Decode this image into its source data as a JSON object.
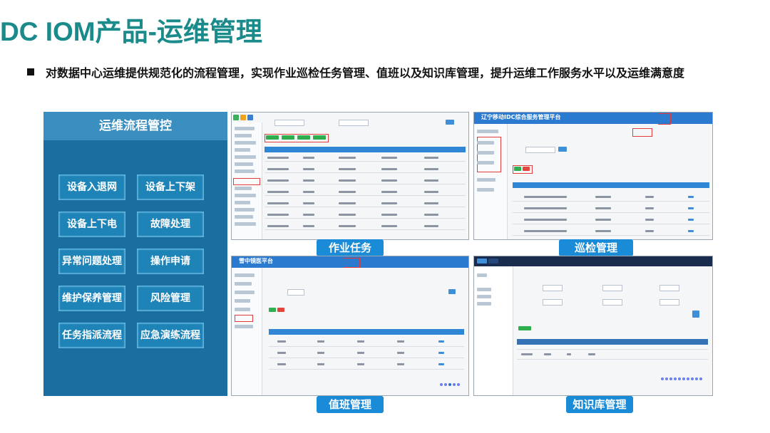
{
  "title": "DC IOM产品-运维管理",
  "bullet": "对数据中心运维提供规范化的流程管理，实现作业巡检任务管理、值班以及知识库管理，提升运维工作服务水平以及运维满意度",
  "left_panel": {
    "title": "运维流程管控",
    "buttons": [
      "设备入退网",
      "设备上下架",
      "设备上下电",
      "故障处理",
      "异常问题处理",
      "操作申请",
      "维护保养管理",
      "风险管理",
      "任务指派流程",
      "应急演练流程"
    ]
  },
  "screenshots": [
    {
      "caption": "作业任务"
    },
    {
      "caption": "巡检管理",
      "brand": "辽宁移动IDC综合服务管理平台"
    },
    {
      "caption": "值班管理",
      "brand": "雪中镜医平台"
    },
    {
      "caption": "知识库管理"
    }
  ],
  "colors": {
    "title": "#1b8a8a",
    "panel": "#1b6ea0",
    "caption": "#1a8bd6"
  }
}
